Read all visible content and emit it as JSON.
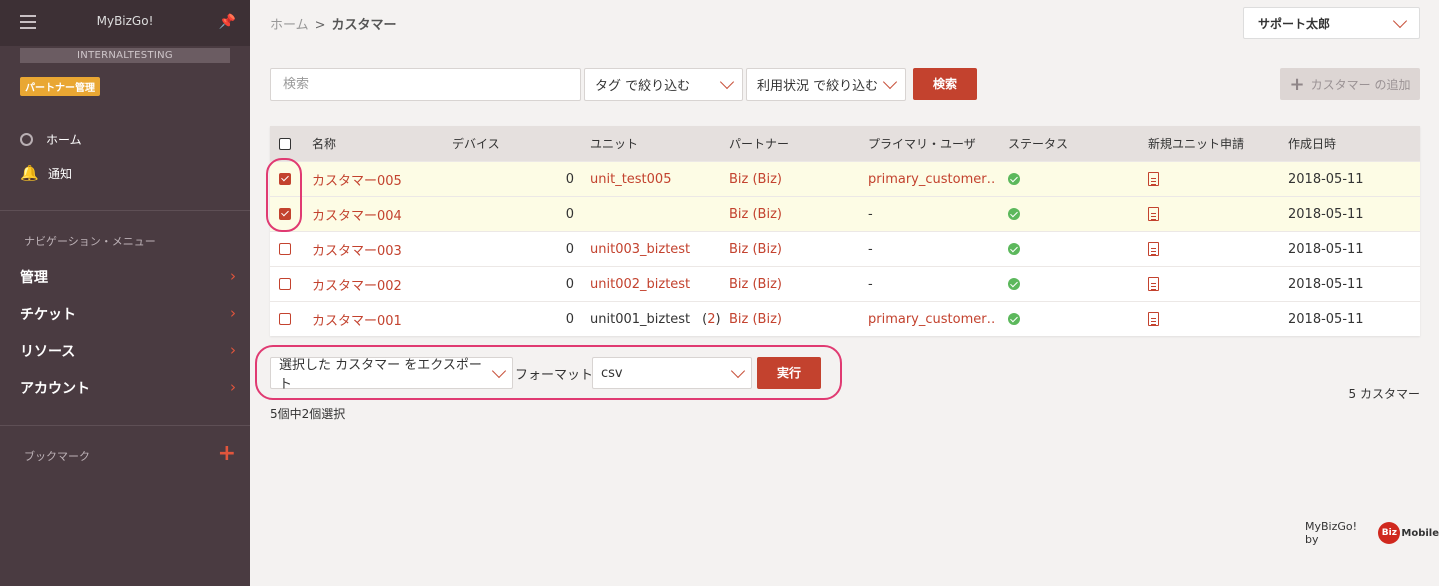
{
  "sidebar": {
    "app_name": "MyBizGo!",
    "env_label": "INTERNALTESTING",
    "badge": "パートナー管理",
    "items": [
      {
        "label": "ホーム",
        "icon": "home-icon"
      },
      {
        "label": "通知",
        "icon": "bell-icon"
      }
    ],
    "nav_section": "ナビゲーション・メニュー",
    "nav": [
      {
        "label": "管理"
      },
      {
        "label": "チケット"
      },
      {
        "label": "リソース"
      },
      {
        "label": "アカウント"
      }
    ],
    "bookmark_label": "ブックマーク"
  },
  "breadcrumb": {
    "home": "ホーム",
    "sep": ">",
    "current": "カスタマー"
  },
  "user": {
    "name": "サポート太郎"
  },
  "search": {
    "placeholder": "検索",
    "tag_filter": "タグ で絞り込む",
    "usage_filter": "利用状況 で絞り込む",
    "button": "検索"
  },
  "add_button": "カスタマー の追加",
  "table": {
    "headers": [
      "名称",
      "デバイス",
      "ユニット",
      "パートナー",
      "プライマリ・ユーザ",
      "ステータス",
      "新規ユニット申請",
      "作成日時"
    ],
    "rows": [
      {
        "selected": true,
        "name": "カスタマー005",
        "devices": "0",
        "unit": "unit_test005",
        "unit_link": true,
        "unit_extra": "",
        "partner": "Biz (Biz)",
        "primary_user": "primary_customer…",
        "status": "ok",
        "created": "2018-05-11"
      },
      {
        "selected": true,
        "name": "カスタマー004",
        "devices": "0",
        "unit": "",
        "unit_link": false,
        "unit_extra": "",
        "partner": "Biz (Biz)",
        "primary_user": "-",
        "status": "ok",
        "created": "2018-05-11"
      },
      {
        "selected": false,
        "name": "カスタマー003",
        "devices": "0",
        "unit": "unit003_biztest",
        "unit_link": true,
        "unit_extra": "",
        "partner": "Biz (Biz)",
        "primary_user": "-",
        "status": "ok",
        "created": "2018-05-11"
      },
      {
        "selected": false,
        "name": "カスタマー002",
        "devices": "0",
        "unit": "unit002_biztest",
        "unit_link": true,
        "unit_extra": "",
        "partner": "Biz (Biz)",
        "primary_user": "-",
        "status": "ok",
        "created": "2018-05-11"
      },
      {
        "selected": false,
        "name": "カスタマー001",
        "devices": "0",
        "unit": "unit001_biztest",
        "unit_link": false,
        "unit_extra": "2",
        "partner": "Biz (Biz)",
        "primary_user": "primary_customer…",
        "status": "ok",
        "created": "2018-05-11"
      }
    ]
  },
  "export": {
    "action": "選択した カスタマー をエクスポート",
    "format_label": "フォーマット",
    "format": "csv",
    "button": "実行"
  },
  "count_text": "5 カスタマー",
  "selected_text": "5個中2個選択",
  "footer": {
    "text": "MyBizGo! by",
    "logo_mark": "Biz",
    "logo_text": "Mobile"
  },
  "colors": {
    "accent": "#c3422e",
    "sidebar": "#4a3b41",
    "highlight": "#e03a72",
    "status_ok": "#5cb85c"
  }
}
